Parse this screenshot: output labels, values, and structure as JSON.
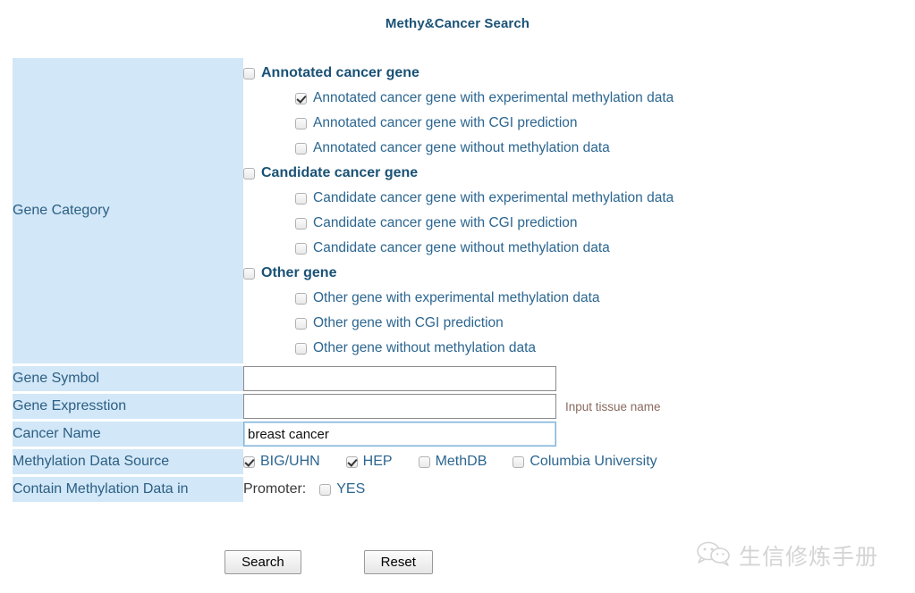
{
  "page": {
    "title": "Methy&Cancer Search"
  },
  "rows": {
    "gene_category_label": "Gene Category",
    "gene_symbol_label": "Gene Symbol",
    "gene_expression_label": "Gene Expresstion",
    "cancer_name_label": "Cancer Name",
    "methylation_source_label": "Methylation Data Source",
    "contain_methylation_label": "Contain Methylation Data in"
  },
  "gene_category": {
    "groups": [
      {
        "parent": {
          "label": "Annotated cancer gene",
          "checked": false
        },
        "children": [
          {
            "label": "Annotated cancer gene with experimental methylation data",
            "checked": true
          },
          {
            "label": "Annotated cancer gene with CGI prediction",
            "checked": false
          },
          {
            "label": "Annotated cancer gene without methylation data",
            "checked": false
          }
        ]
      },
      {
        "parent": {
          "label": "Candidate cancer gene",
          "checked": false
        },
        "children": [
          {
            "label": "Candidate cancer gene with experimental methylation data",
            "checked": false
          },
          {
            "label": "Candidate cancer gene with CGI prediction",
            "checked": false
          },
          {
            "label": "Candidate cancer gene without methylation data",
            "checked": false
          }
        ]
      },
      {
        "parent": {
          "label": "Other gene",
          "checked": false
        },
        "children": [
          {
            "label": "Other gene with experimental methylation data",
            "checked": false
          },
          {
            "label": "Other gene with CGI prediction",
            "checked": false
          },
          {
            "label": "Other gene without methylation data",
            "checked": false
          }
        ]
      }
    ]
  },
  "fields": {
    "gene_symbol": {
      "value": "",
      "placeholder": ""
    },
    "gene_expression": {
      "value": "",
      "placeholder": "",
      "hint": "Input tissue name"
    },
    "cancer_name": {
      "value": "breast cancer",
      "placeholder": "",
      "focused": true
    }
  },
  "methylation_sources": [
    {
      "label": "BIG/UHN",
      "checked": true
    },
    {
      "label": "HEP",
      "checked": true
    },
    {
      "label": "MethDB",
      "checked": false
    },
    {
      "label": "Columbia University",
      "checked": false
    }
  ],
  "contain_methylation": {
    "prefix": "Promoter:",
    "option": {
      "label": "YES",
      "checked": false
    }
  },
  "buttons": {
    "search": "Search",
    "reset": "Reset"
  },
  "watermark": {
    "text": "生信修炼手册",
    "icon": "wechat-icon"
  },
  "colors": {
    "label_cell_bg": "#d2e7f7",
    "label_text": "#2c5f84",
    "heading_text": "#1a5276",
    "child_text": "#2c6690",
    "hint_text": "#8a6a5f",
    "focused_border": "#7fb2d9"
  }
}
